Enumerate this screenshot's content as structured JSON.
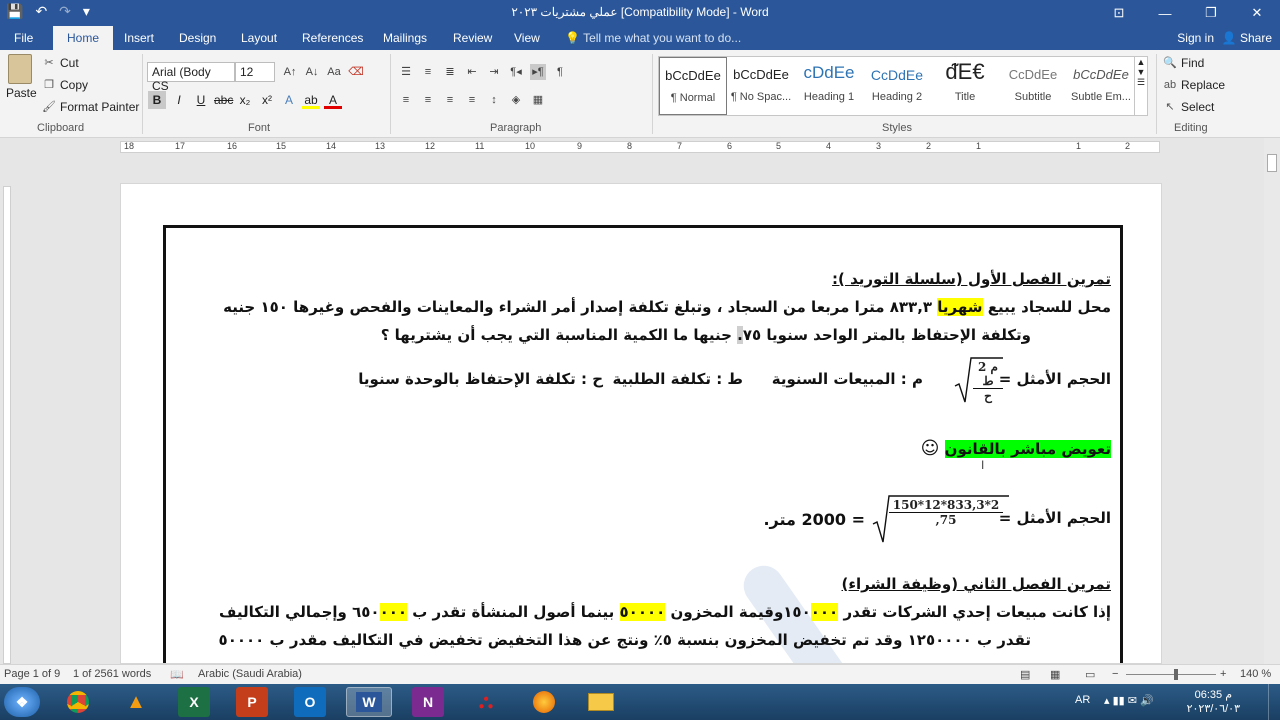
{
  "window": {
    "title": "عملي مشتريات ٢٠٢٣ [Compatibility Mode] - Word",
    "quick_access": {
      "save": "💾",
      "undo": "↶",
      "redo": "↷",
      "more": "▾"
    },
    "controls": {
      "restore_ribbon": "⊡",
      "minimize": "—",
      "maximize": "❐",
      "close": "✕"
    }
  },
  "menu": {
    "tabs": [
      "File",
      "Home",
      "Insert",
      "Design",
      "Layout",
      "References",
      "Mailings",
      "Review",
      "View"
    ],
    "tell_me": "Tell me what you want to do...",
    "sign_in": "Sign in",
    "share": "Share"
  },
  "ribbon": {
    "clipboard": {
      "paste": "Paste",
      "cut": "Cut",
      "copy": "Copy",
      "format_painter": "Format Painter",
      "label": "Clipboard"
    },
    "font": {
      "name": "Arial (Body CS",
      "size": "12",
      "label": "Font"
    },
    "paragraph": {
      "label": "Paragraph"
    },
    "styles": {
      "label": "Styles",
      "items": [
        {
          "preview": "bCcDdEe",
          "name": "¶ Normal"
        },
        {
          "preview": "bCcDdEe",
          "name": "¶ No Spac..."
        },
        {
          "preview": "cDdEe",
          "name": "Heading 1"
        },
        {
          "preview": "CcDdEe",
          "name": "Heading 2"
        },
        {
          "preview": "ᵭE€",
          "name": "Title"
        },
        {
          "preview": "CcDdEe",
          "name": "Subtitle"
        },
        {
          "preview": "bCcDdEe",
          "name": "Subtle Em..."
        }
      ]
    },
    "editing": {
      "find": "Find",
      "replace": "Replace",
      "select": "Select",
      "label": "Editing"
    }
  },
  "ruler": {
    "numbers": [
      "18",
      "17",
      "16",
      "15",
      "14",
      "13",
      "12",
      "11",
      "10",
      "9",
      "8",
      "7",
      "6",
      "5",
      "4",
      "3",
      "2",
      "1",
      "1",
      "2"
    ]
  },
  "document": {
    "heading1": "تمرين الفصل الأول (سلسلة التوريد ):",
    "p1_line1": {
      "a": "محل للسجاد يبيع",
      "hl": "شهريا",
      "b": "٨٣٣,٣ مترا مربعا من السجاد ، وتبلغ تكلفة إصدار أمر الشراء والمعاينات والفحص وغيرها ١٥٠ جنيه"
    },
    "p1_line2": {
      "a": "وتكلفة الإحتفاظ بالمتر الواحد سنويا ٧٥",
      "gray": ".",
      "b": "جنيها ما الكمية المناسبة التي يجب أن يشتريها ؟"
    },
    "formula1": {
      "label": "الحجم الأمثل =",
      "numerator": "2 م ط",
      "denominator": "ح"
    },
    "legend": {
      "m": "م : المبيعات السنوية",
      "t": "ط : تكلفة الطلبية",
      "h": "ح : تكلفة الإحتفاظ بالوحدة سنويا"
    },
    "direct_sub": {
      "text": "تعويض مباشر بالقانون",
      "emoji": "☺"
    },
    "formula2": {
      "label": "الحجم الأمثل =",
      "numerator": "150*12*833,3*2",
      "denominator": ",75",
      "result": "= 2000 متر."
    },
    "heading2": "تمرين الفصل الثاني (وظيفة الشراء)",
    "p2_line1": {
      "a": "إذا كانت مبيعات إحدي الشركات تقدر ١٥٠",
      "hl1": "٠٠٠",
      "b": "وقيمة المخزون",
      "hl2": "٥٠٠٠٠",
      "c": "بينما أصول المنشأة تقدر ب ٦٥٠",
      "hl3": "٠٠٠",
      "d": "وإجمالي التكاليف"
    },
    "p2_line2": "تقدر ب ١٢٥٠٠٠٠ وقد تم تخفيض المخزون بنسبة ٥٪ ونتج عن هذا التخفيض تخفيض في التكاليف مقدر ب ٥٠٠٠٠"
  },
  "status": {
    "page": "Page 1 of 9",
    "words": "1 of 2561 words",
    "language": "Arabic (Saudi Arabia)",
    "zoom": "140 %"
  },
  "taskbar": {
    "apps": [
      "start",
      "chrome",
      "vlc",
      "excel",
      "powerpoint",
      "outlook",
      "word",
      "onenote",
      "acrobat",
      "firefox",
      "explorer"
    ],
    "lang": "AR",
    "time": "06:35 م",
    "date": "٢٠٢٣/٠٦/٠٣"
  },
  "colors": {
    "accent": "#2b579a",
    "highlight_yellow": "#ffff00",
    "highlight_green": "#00ff00"
  }
}
